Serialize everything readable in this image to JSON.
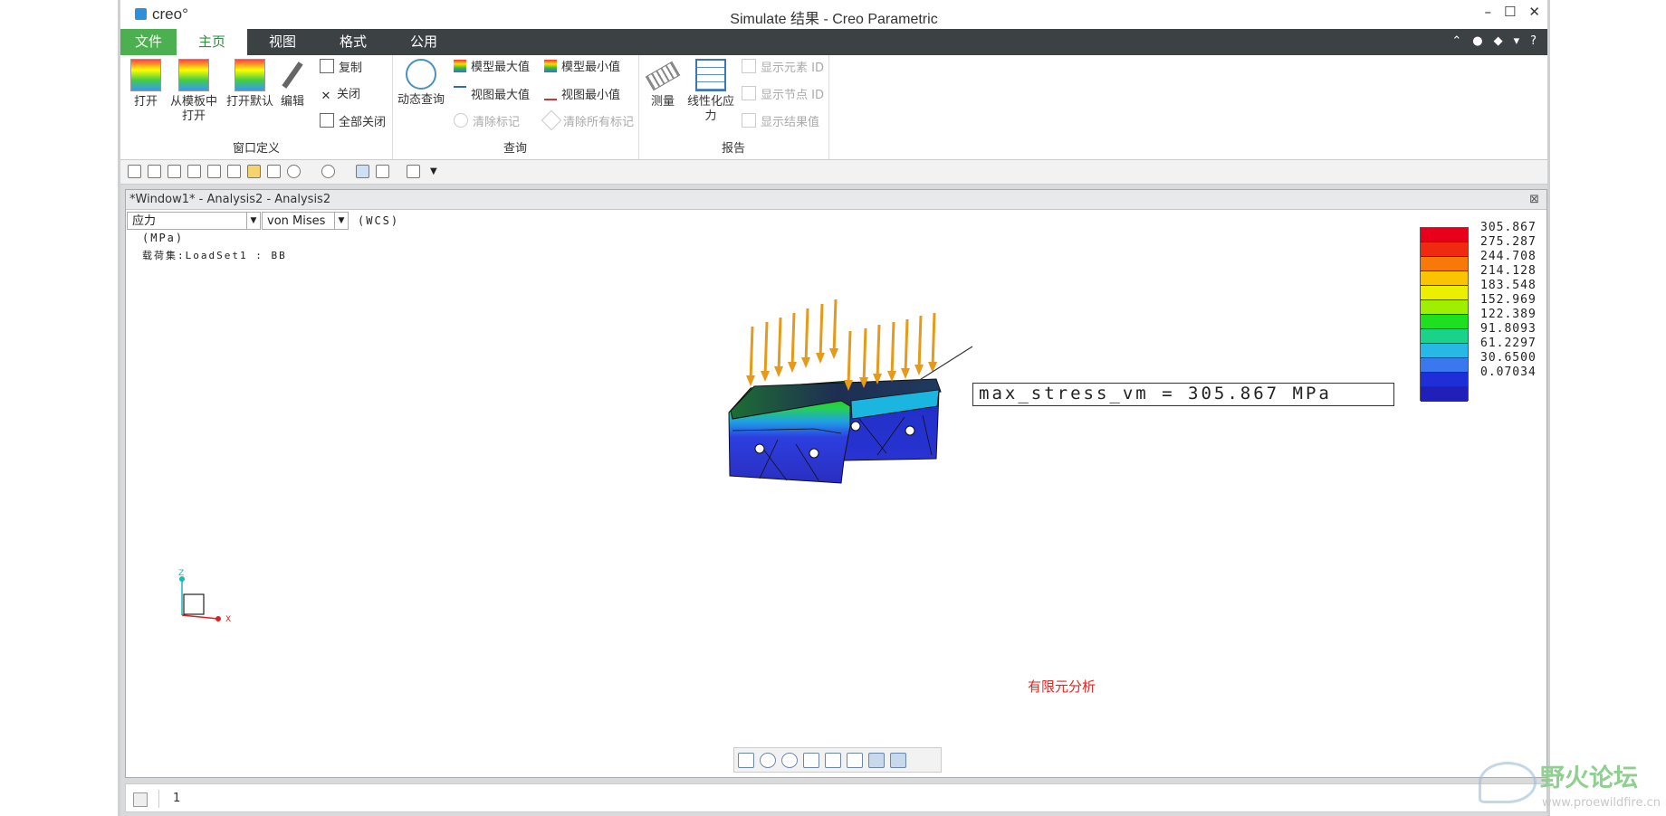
{
  "app": {
    "logo_text": "creo°",
    "window_title": "Simulate 结果 - Creo Parametric",
    "window_controls": [
      "–",
      "☐",
      "✕"
    ]
  },
  "ribbon_tabs": [
    "文件",
    "主页",
    "视图",
    "格式",
    "公用"
  ],
  "ribbon_help_icons": [
    "⌃",
    "●",
    "◆",
    "▾",
    "?"
  ],
  "ribbon": {
    "window_def": {
      "open": "打开",
      "open_template": [
        "从模板中",
        "打开"
      ],
      "open_default": "打开默认",
      "edit": "编辑",
      "copy": "复制",
      "close": "关闭",
      "close_all": "全部关闭",
      "group_label": "窗口定义"
    },
    "query": {
      "dynamic_query": "动态查询",
      "model_max": "模型最大值",
      "model_min": "模型最小值",
      "view_max": "视图最大值",
      "view_min": "视图最小值",
      "clear_marks": "清除标记",
      "clear_all_marks": "清除所有标记",
      "group_label": "查询"
    },
    "report": {
      "measure": "测量",
      "linearize": [
        "线性化应",
        "力"
      ],
      "show_element_id": "显示元素 ID",
      "show_node_id": "显示节点 ID",
      "show_result": "显示结果值",
      "group_label": "报告"
    }
  },
  "view_window": {
    "title": "*Window1* - Analysis2 - Analysis2",
    "close_icon": "⊠",
    "quantity_select": "应力",
    "component_select": "von Mises",
    "csys": "(WCS)",
    "units": "(MPa)",
    "loadset": "载荷集:LoadSet1 :  BB",
    "annotation": "max_stress_vm = 305.867  MPa",
    "fea_label": "有限元分析",
    "axis_labels": {
      "z": "Z",
      "x": "X"
    }
  },
  "legend": {
    "values": [
      "305.867",
      "275.287",
      "244.708",
      "214.128",
      "183.548",
      "152.969",
      "122.389",
      "91.8093",
      "61.2297",
      "30.6500",
      "0.07034"
    ],
    "colors": [
      "#e8001a",
      "#f02a10",
      "#f77a08",
      "#fbc400",
      "#eaf000",
      "#9ef000",
      "#1fe020",
      "#1bd28a",
      "#27b8e6",
      "#3b78f0",
      "#1f2fd8",
      "#2020b8"
    ]
  },
  "status": {
    "number": "1"
  },
  "watermark": {
    "text": "野火论坛",
    "url": "www.proewildfire.cn"
  }
}
